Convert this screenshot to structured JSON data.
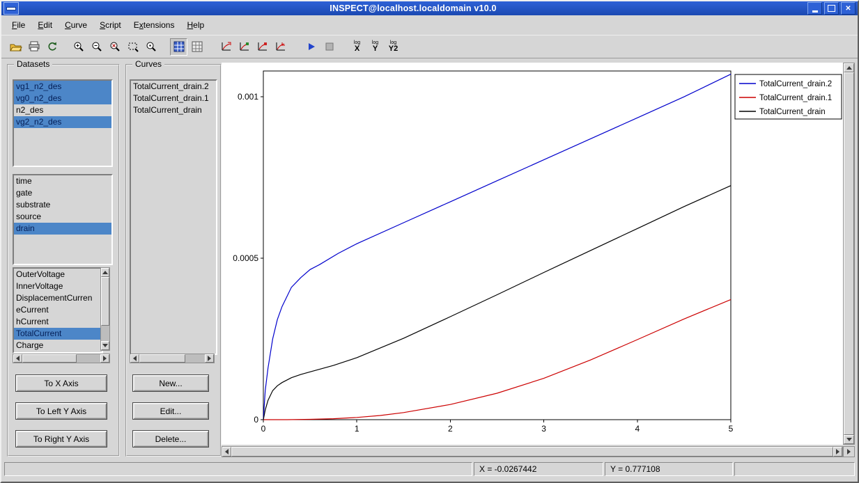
{
  "window": {
    "title": "INSPECT@localhost.localdomain v10.0"
  },
  "menu_bar": {
    "items": [
      {
        "label": "File",
        "mnemonic": 0
      },
      {
        "label": "Edit",
        "mnemonic": 0
      },
      {
        "label": "Curve",
        "mnemonic": 0
      },
      {
        "label": "Script",
        "mnemonic": 0
      },
      {
        "label": "Extensions",
        "mnemonic": 1
      },
      {
        "label": "Help",
        "mnemonic": 0
      }
    ]
  },
  "toolbar": {
    "log_buttons": [
      {
        "sup": "log",
        "label": "X"
      },
      {
        "sup": "log",
        "label": "Y"
      },
      {
        "sup": "log",
        "label": "Y2"
      }
    ]
  },
  "datasets_panel": {
    "title": "Datasets",
    "dataset_list": [
      {
        "label": "vg1_n2_des",
        "selected": true
      },
      {
        "label": "vg0_n2_des",
        "selected": true
      },
      {
        "label": "n2_des",
        "selected": false
      },
      {
        "label": "vg2_n2_des",
        "selected": true
      }
    ],
    "terminal_list": [
      {
        "label": "time",
        "selected": false
      },
      {
        "label": "gate",
        "selected": false
      },
      {
        "label": "substrate",
        "selected": false
      },
      {
        "label": "source",
        "selected": false
      },
      {
        "label": "drain",
        "selected": true
      }
    ],
    "quantity_list": [
      {
        "label": "OuterVoltage",
        "selected": false
      },
      {
        "label": "InnerVoltage",
        "selected": false
      },
      {
        "label": "DisplacementCurren",
        "selected": false
      },
      {
        "label": "eCurrent",
        "selected": false
      },
      {
        "label": "hCurrent",
        "selected": false
      },
      {
        "label": "TotalCurrent",
        "selected": true
      },
      {
        "label": "Charge",
        "selected": false
      }
    ],
    "buttons": {
      "to_x": "To X Axis",
      "to_left_y": "To Left Y Axis",
      "to_right_y": "To Right Y Axis"
    }
  },
  "curves_panel": {
    "title": "Curves",
    "curve_list": [
      {
        "label": "TotalCurrent_drain.2",
        "selected": false
      },
      {
        "label": "TotalCurrent_drain.1",
        "selected": false
      },
      {
        "label": "TotalCurrent_drain",
        "selected": false
      }
    ],
    "buttons": {
      "new": "New...",
      "edit": "Edit...",
      "delete": "Delete..."
    }
  },
  "status_bar": {
    "x_readout": "X = -0.0267442",
    "y_readout": "Y = 0.777108"
  },
  "chart_data": {
    "type": "line",
    "title": "",
    "xlabel": "",
    "ylabel": "",
    "xlim": [
      0,
      5
    ],
    "ylim": [
      0,
      0.00108
    ],
    "xticks": [
      0,
      1,
      2,
      3,
      4,
      5
    ],
    "xtick_labels": [
      "0",
      "1",
      "2",
      "3",
      "4",
      "5"
    ],
    "yticks": [
      0,
      0.0005,
      0.001
    ],
    "ytick_labels": [
      "0",
      "0.0005",
      "0.001"
    ],
    "grid": false,
    "legend_position": "top-right",
    "series": [
      {
        "name": "TotalCurrent_drain.2",
        "color": "#0000cc",
        "x": [
          0,
          0.02,
          0.05,
          0.1,
          0.15,
          0.2,
          0.3,
          0.4,
          0.5,
          0.6,
          0.8,
          1.0,
          1.5,
          2.0,
          2.5,
          3.0,
          3.5,
          4.0,
          4.5,
          5.0
        ],
        "y": [
          0,
          9e-05,
          0.00016,
          0.00025,
          0.00031,
          0.00035,
          0.00041,
          0.00044,
          0.000465,
          0.00048,
          0.000515,
          0.000545,
          0.00061,
          0.000675,
          0.00074,
          0.000805,
          0.00087,
          0.000935,
          0.001,
          0.00107
        ]
      },
      {
        "name": "TotalCurrent_drain.1",
        "color": "#cc0000",
        "x": [
          0,
          0.25,
          0.5,
          0.75,
          1.0,
          1.25,
          1.5,
          2.0,
          2.5,
          3.0,
          3.5,
          4.0,
          4.5,
          5.0
        ],
        "y": [
          0,
          0,
          1e-06,
          3e-06,
          7e-06,
          1.3e-05,
          2.2e-05,
          4.7e-05,
          8.2e-05,
          0.000128,
          0.000185,
          0.000248,
          0.000312,
          0.000372
        ]
      },
      {
        "name": "TotalCurrent_drain",
        "color": "#000000",
        "x": [
          0,
          0.02,
          0.05,
          0.1,
          0.15,
          0.2,
          0.3,
          0.4,
          0.5,
          0.75,
          1.0,
          1.5,
          2.0,
          2.5,
          3.0,
          3.5,
          4.0,
          4.5,
          5.0
        ],
        "y": [
          0,
          3e-05,
          6e-05,
          9e-05,
          0.000105,
          0.000115,
          0.00013,
          0.00014,
          0.000148,
          0.000168,
          0.000192,
          0.000252,
          0.000319,
          0.000387,
          0.000456,
          0.000524,
          0.000592,
          0.00066,
          0.000725
        ]
      }
    ]
  }
}
